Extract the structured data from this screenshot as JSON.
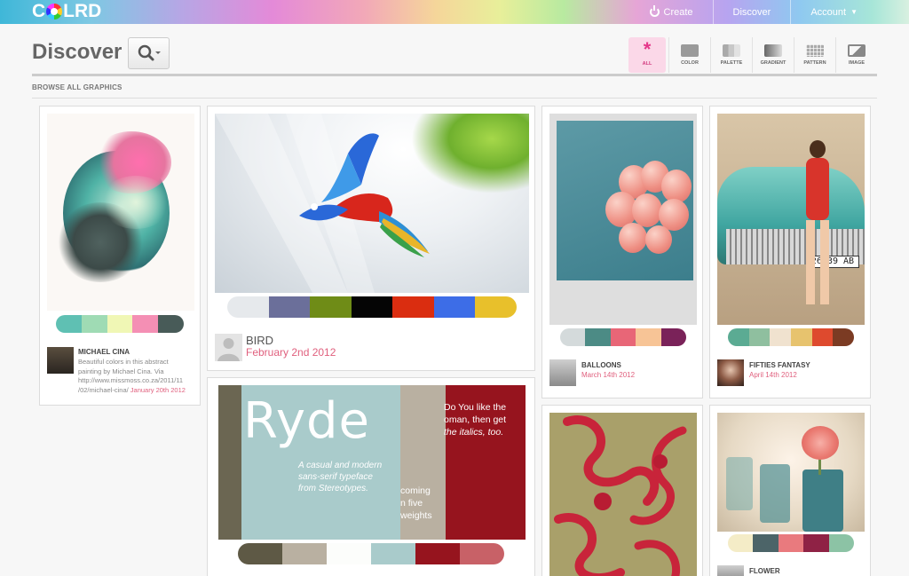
{
  "brand": {
    "logo_c": "C",
    "logo_rest": "LRD"
  },
  "topnav": {
    "create": "Create",
    "discover": "Discover",
    "account": "Account"
  },
  "header": {
    "title": "Discover",
    "section_label": "BROWSE ALL GRAPHICS"
  },
  "filters": [
    {
      "label": "ALL",
      "icon": "asterisk-icon",
      "active": true
    },
    {
      "label": "COLOR",
      "icon": "color-swatch-icon"
    },
    {
      "label": "PALETTE",
      "icon": "palette-icon"
    },
    {
      "label": "GRADIENT",
      "icon": "gradient-icon"
    },
    {
      "label": "PATTERN",
      "icon": "pattern-grid-icon"
    },
    {
      "label": "IMAGE",
      "icon": "image-icon"
    }
  ],
  "cards": {
    "michael": {
      "name": "MICHAEL CINA",
      "desc1": "Beautiful colors in this abstract",
      "desc2": "painting by Michael Cina. Via",
      "desc3": "http://www.missmoss.co.za/2011/11",
      "desc4": "/02/michael-cina/",
      "date": "January 20th 2012",
      "palette": [
        "#5fc0b3",
        "#9fdbb4",
        "#f0f7b5",
        "#f48fb4",
        "#485b58"
      ]
    },
    "bird": {
      "name": "BIRD",
      "date": "February 2nd 2012",
      "palette": [
        "#e6e9ec",
        "#6b6f9a",
        "#6f8c17",
        "#050505",
        "#da2d10",
        "#3d6de7",
        "#e8c02b"
      ]
    },
    "balloons": {
      "name": "BALLOONS",
      "date": "March 14th 2012",
      "palette": [
        "#d4dadb",
        "#4c8b85",
        "#e86677",
        "#f7c496",
        "#7a2259"
      ]
    },
    "fifties": {
      "name": "FIFTIES FANTASY",
      "date": "April 14th 2012",
      "palette": [
        "#5bab93",
        "#8fbf9f",
        "#f0e2cf",
        "#e7c36e",
        "#de4a2e",
        "#7b3b23"
      ]
    },
    "ryde": {
      "title": "Ryde",
      "tag1": "A casual and modern",
      "tag2": "sans-serif typeface",
      "tag3": "from Stereotypes.",
      "side1": "coming",
      "side2": "n five",
      "side3": "weights",
      "red1": "Do You like the",
      "red2": "oman, then get",
      "red3": "the italics, too.",
      "palette": [
        "#5e5945",
        "#b9b0a1",
        "#fcfdfb",
        "#a9cbcb",
        "#96141e",
        "#c86167"
      ]
    },
    "flower": {
      "name": "FLOWER",
      "palette": [
        "#f4ecc7",
        "#4c6468",
        "#e97a7e",
        "#8f2245",
        "#8cc3a5"
      ]
    }
  }
}
